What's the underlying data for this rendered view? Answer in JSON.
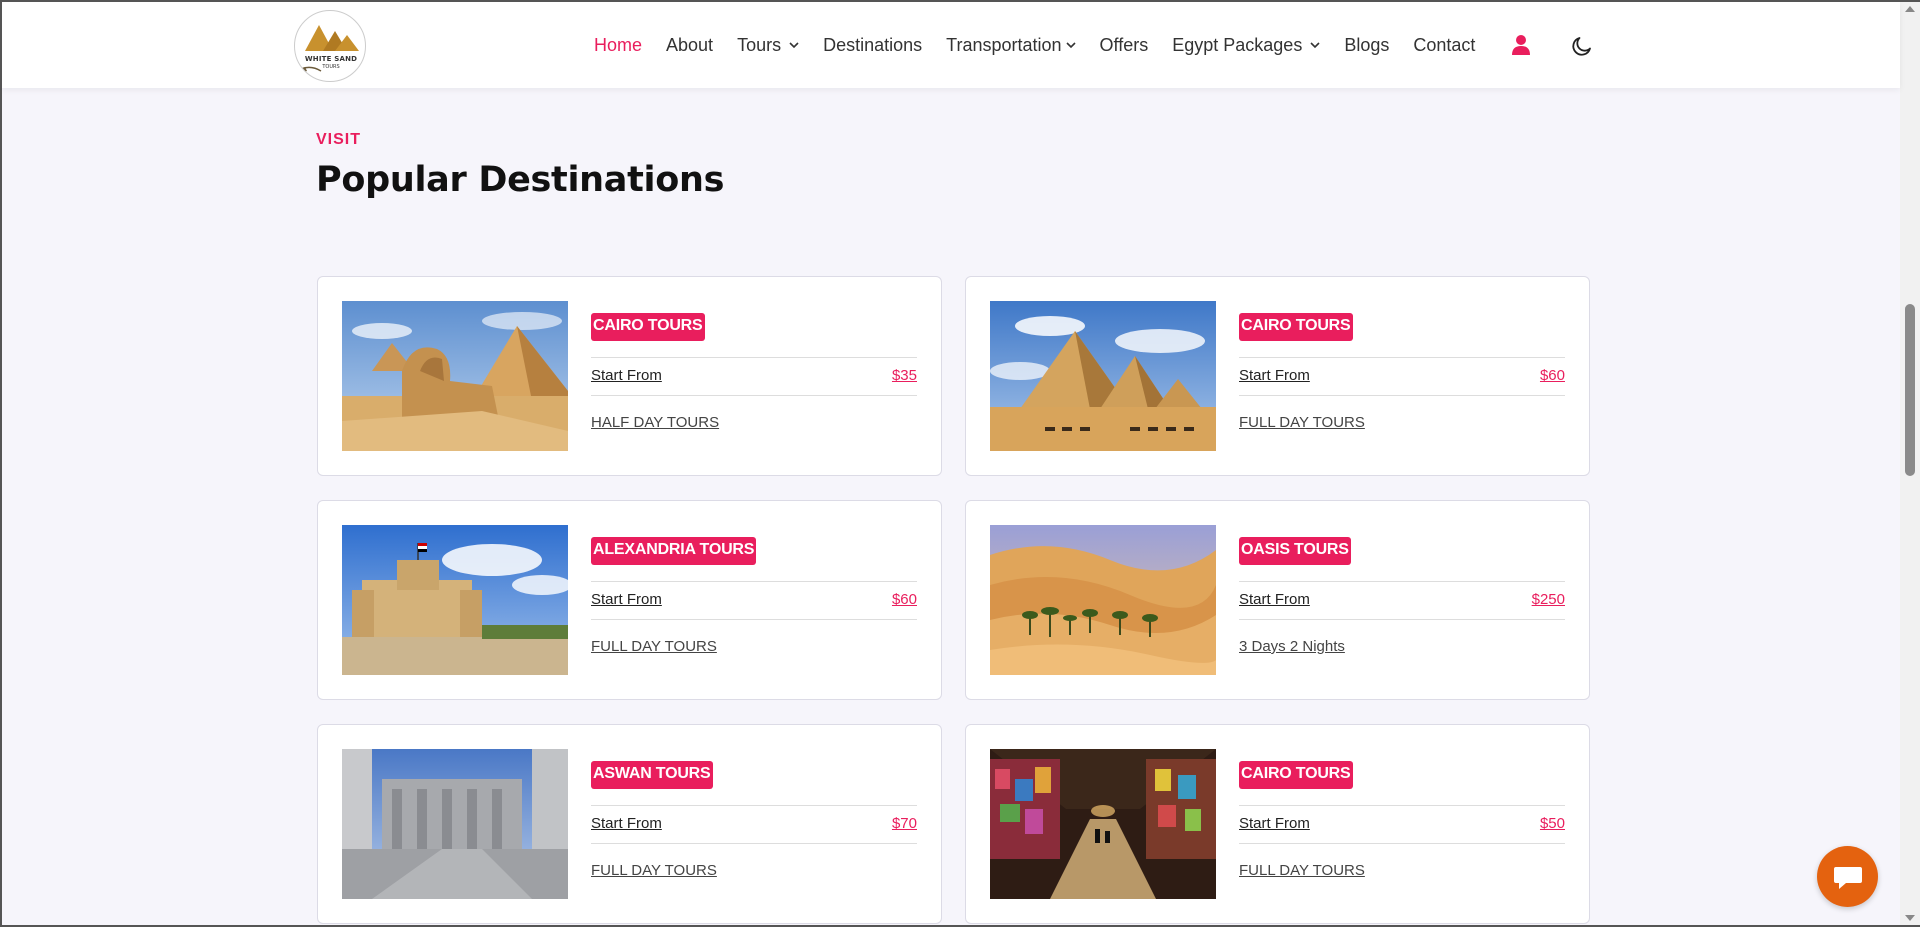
{
  "brand": {
    "logo_text": "WHITE SAND",
    "logo_subtext": "TOURS"
  },
  "nav": {
    "items": [
      {
        "label": "Home",
        "active": true,
        "dropdown": false
      },
      {
        "label": "About",
        "active": false,
        "dropdown": false
      },
      {
        "label": "Tours",
        "active": false,
        "dropdown": true
      },
      {
        "label": "Destinations",
        "active": false,
        "dropdown": false
      },
      {
        "label": "Transportation",
        "active": false,
        "dropdown": true
      },
      {
        "label": "Offers",
        "active": false,
        "dropdown": false
      },
      {
        "label": "Egypt Packages",
        "active": false,
        "dropdown": true
      },
      {
        "label": "Blogs",
        "active": false,
        "dropdown": false
      },
      {
        "label": "Contact",
        "active": false,
        "dropdown": false
      }
    ],
    "user_icon": "user-icon",
    "theme_icon": "moon-icon"
  },
  "section": {
    "eyebrow": "VISIT",
    "title": "Popular Destinations"
  },
  "cards": [
    {
      "category": "CAIRO TOURS",
      "start_label": "Start From",
      "price": "$35",
      "duration": "HALF DAY TOURS",
      "image": "sphinx-pyramids"
    },
    {
      "category": "CAIRO TOURS",
      "start_label": "Start From",
      "price": "$60",
      "duration": "FULL DAY TOURS",
      "image": "giza-pyramids-camels"
    },
    {
      "category": "ALEXANDRIA TOURS",
      "start_label": "Start From",
      "price": "$60",
      "duration": "FULL DAY TOURS",
      "image": "qaitbay-citadel"
    },
    {
      "category": "OASIS TOURS",
      "start_label": "Start From",
      "price": "$250",
      "duration": "3 Days 2 Nights",
      "image": "desert-oasis"
    },
    {
      "category": "ASWAN TOURS",
      "start_label": "Start From",
      "price": "$70",
      "duration": "FULL DAY TOURS",
      "image": "kom-ombo-temple"
    },
    {
      "category": "CAIRO TOURS",
      "start_label": "Start From",
      "price": "$50",
      "duration": "FULL DAY TOURS",
      "image": "khan-el-khalili-market"
    }
  ],
  "colors": {
    "accent": "#e91e5d",
    "background": "#f6f5fb",
    "chat": "#e4620f"
  },
  "chat": {
    "icon": "chat-bubble-icon"
  }
}
